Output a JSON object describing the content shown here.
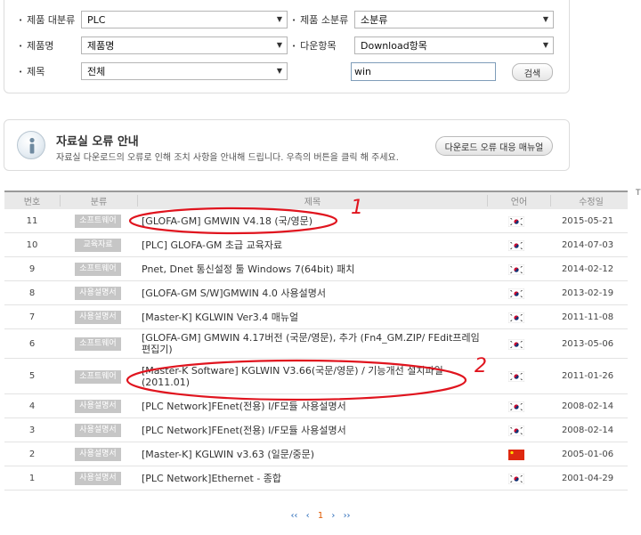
{
  "filters": {
    "category_label": "제품 대분류",
    "category_value": "PLC",
    "subcategory_label": "제품 소분류",
    "subcategory_value": "소분류",
    "product_label": "제품명",
    "product_value": "제품명",
    "download_label": "다운항목",
    "download_value": "Download항목",
    "title_label": "제목",
    "title_value": "전체",
    "keyword_value": "win",
    "search_label": "검색"
  },
  "notice": {
    "title": "자료실 오류 안내",
    "text": "자료실 다운로드의 오류로 인해 조치 사항을 안내해 드립니다. 우측의 버튼을 클릭 해 주세요.",
    "button": "다운로드 오류 대응 매뉴얼"
  },
  "table": {
    "headers": {
      "no": "번호",
      "category": "분류",
      "title": "제목",
      "lang": "언어",
      "date": "수정일"
    },
    "rows": [
      {
        "no": "11",
        "category": "소프트웨어",
        "title": "[GLOFA-GM] GMWIN V4.18 (국/영문)",
        "flag": "kr",
        "date": "2015-05-21"
      },
      {
        "no": "10",
        "category": "교육자료",
        "title": "[PLC] GLOFA-GM 초급 교육자료",
        "flag": "kr",
        "date": "2014-07-03"
      },
      {
        "no": "9",
        "category": "소프트웨어",
        "title": "Pnet, Dnet 통신설정 툴 Windows 7(64bit) 패치",
        "flag": "kr",
        "date": "2014-02-12"
      },
      {
        "no": "8",
        "category": "사용설명서",
        "title": "[GLOFA-GM S/W]GMWIN 4.0 사용설명서",
        "flag": "kr",
        "date": "2013-02-19"
      },
      {
        "no": "7",
        "category": "사용설명서",
        "title": "[Master-K] KGLWIN Ver3.4 매뉴얼",
        "flag": "kr",
        "date": "2011-11-08"
      },
      {
        "no": "6",
        "category": "소프트웨어",
        "title": "[GLOFA-GM] GMWIN 4.17버전 (국문/영문), 추가 (Fn4_GM.ZIP/ FEdit프레임편집기)",
        "flag": "kr",
        "date": "2013-05-06"
      },
      {
        "no": "5",
        "category": "소프트웨어",
        "title": "[Master-K Software] KGLWIN V3.66(국문/영문) / 기능개선 설치파일(2011.01)",
        "flag": "kr",
        "date": "2011-01-26"
      },
      {
        "no": "4",
        "category": "사용설명서",
        "title": "[PLC Network]FEnet(전용) I/F모듈 사용설명서",
        "flag": "kr",
        "date": "2008-02-14"
      },
      {
        "no": "3",
        "category": "사용설명서",
        "title": "[PLC Network]FEnet(전용) I/F모듈 사용설명서",
        "flag": "kr",
        "date": "2008-02-14"
      },
      {
        "no": "2",
        "category": "사용설명서",
        "title": "[Master-K] KGLWIN v3.63 (일문/중문)",
        "flag": "cn",
        "date": "2005-01-06"
      },
      {
        "no": "1",
        "category": "사용설명서",
        "title": "[PLC Network]Ethernet - 종합",
        "flag": "kr",
        "date": "2001-04-29"
      }
    ]
  },
  "annotations": {
    "first": "1",
    "second": "2"
  },
  "pager": {
    "first": "‹‹",
    "prev": "‹",
    "current": "1",
    "next": "›",
    "last": "››"
  },
  "edge_text": "T",
  "colors": {
    "annotation": "#e0141e",
    "badge": "#c6c6c6",
    "pager_current": "#e05a00",
    "pager_link": "#2a6bb8"
  }
}
